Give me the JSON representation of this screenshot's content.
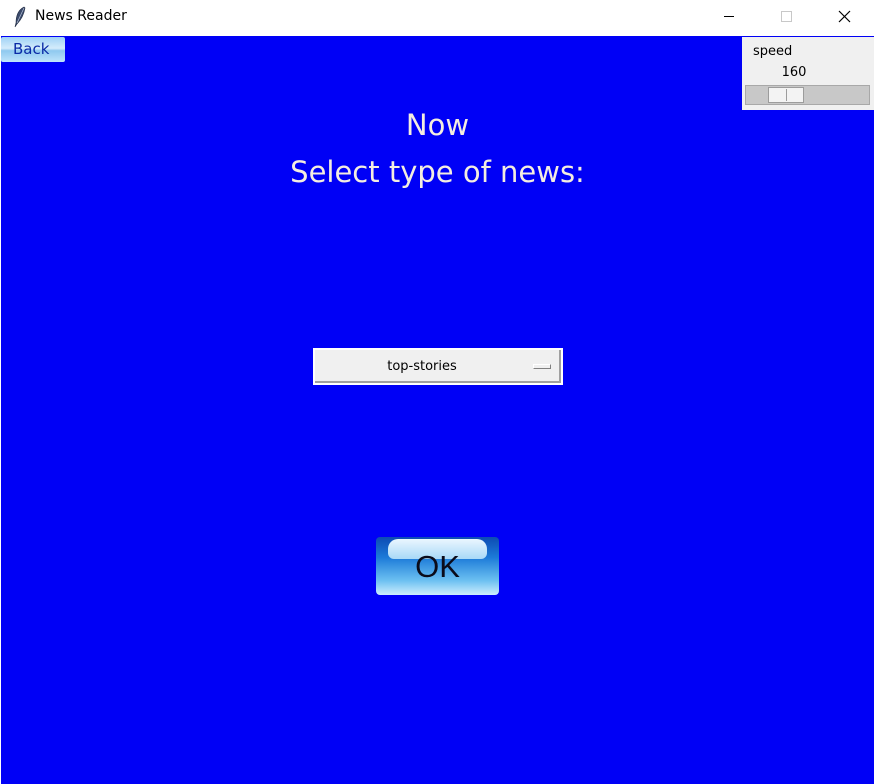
{
  "window": {
    "title": "News Reader",
    "icon": "feather-icon",
    "controls": [
      "minimize-icon",
      "maximize-icon",
      "close-icon"
    ]
  },
  "colors": {
    "background": "#0000f6",
    "heading_text": "#f4ede0",
    "panel": "#f0f0f0"
  },
  "back_button": {
    "label": "Back"
  },
  "speed": {
    "label": "speed",
    "value": "160",
    "slider_position_fraction": 0.25
  },
  "heading": {
    "line1": "Now",
    "line2": "Select type of news:"
  },
  "news_type_select": {
    "selected": "top-stories"
  },
  "ok_button": {
    "label": "OK"
  }
}
